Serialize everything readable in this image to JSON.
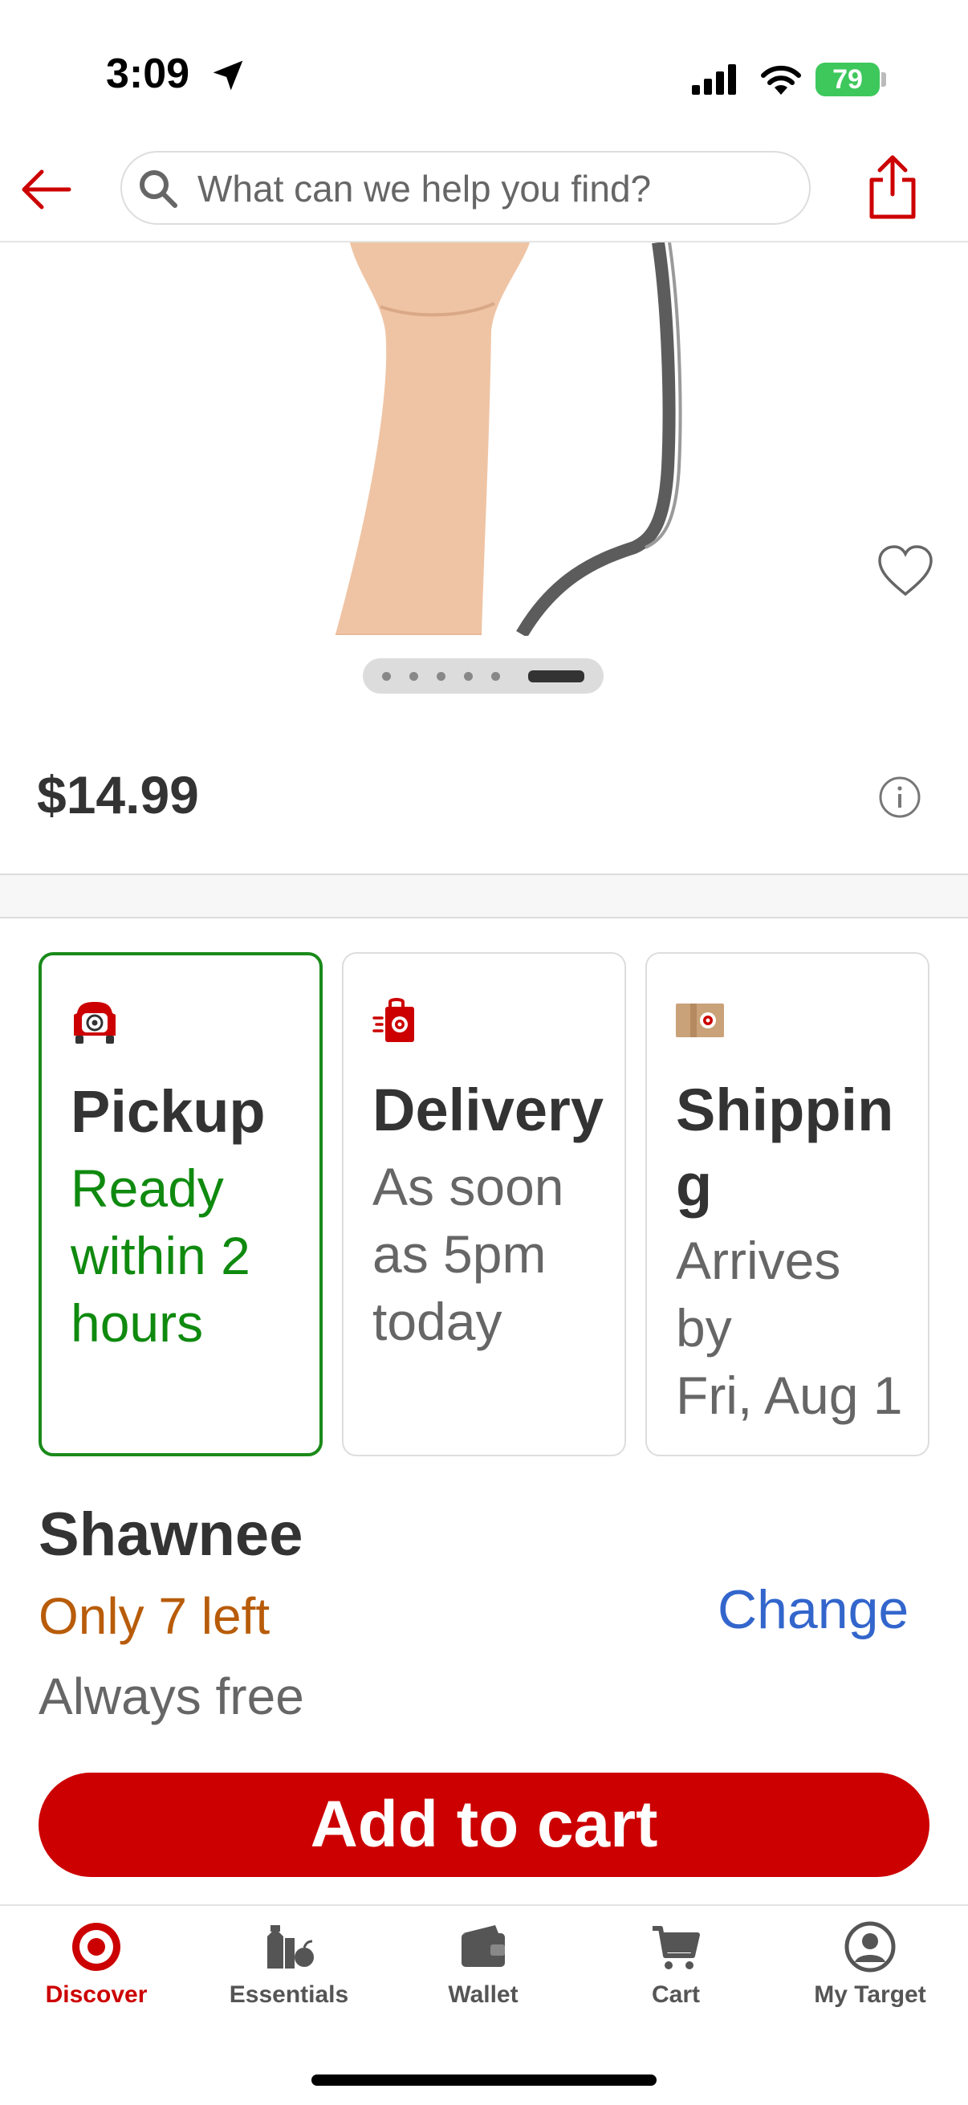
{
  "status_bar": {
    "time": "3:09",
    "battery": "79"
  },
  "header": {
    "search_placeholder": "What can we help you find?"
  },
  "product": {
    "price": "$14.99",
    "image_count": 6,
    "active_image": 6
  },
  "fulfillment": [
    {
      "title": "Pickup",
      "subtitle_lines": [
        "Ready",
        "within 2",
        "hours"
      ],
      "selected": true
    },
    {
      "title": "Delivery",
      "subtitle_lines": [
        "As soon",
        "as 5pm",
        "today"
      ],
      "selected": false
    },
    {
      "title_lines": [
        "Shippin",
        "g"
      ],
      "subtitle_lines": [
        "Arrives",
        "by",
        "Fri, Aug 1"
      ],
      "selected": false
    }
  ],
  "store": {
    "name": "Shawnee",
    "stock": "Only 7 left",
    "change_label": "Change",
    "price_note": "Always free"
  },
  "add_to_cart_label": "Add to cart",
  "nav": [
    {
      "label": "Discover",
      "icon": "target-bullseye-icon",
      "active": true
    },
    {
      "label": "Essentials",
      "icon": "essentials-icon",
      "active": false
    },
    {
      "label": "Wallet",
      "icon": "wallet-icon",
      "active": false
    },
    {
      "label": "Cart",
      "icon": "cart-icon",
      "active": false
    },
    {
      "label": "My Target",
      "icon": "account-icon",
      "active": false
    }
  ],
  "colors": {
    "brand_red": "#cc0000",
    "pickup_green": "#0f8a0f",
    "stock_orange": "#b85c0a",
    "link_blue": "#3366cc"
  }
}
